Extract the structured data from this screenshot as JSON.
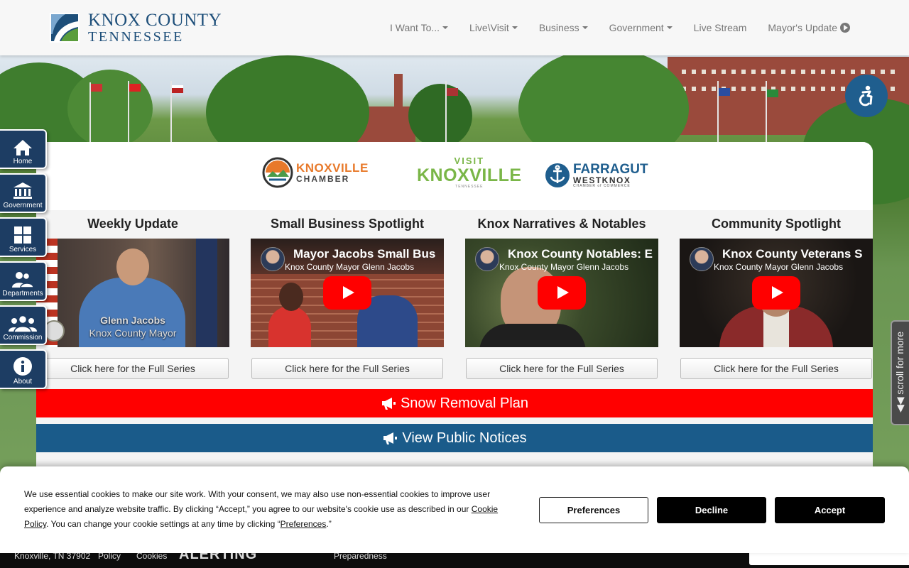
{
  "header": {
    "logo_line1": "KNOX COUNTY",
    "logo_line2": "TENNESSEE",
    "nav": [
      {
        "label": "I Want To...",
        "icon": "caret-down-icon"
      },
      {
        "label": "Live\\Visit",
        "icon": "caret-down-icon"
      },
      {
        "label": "Business",
        "icon": "caret-down-icon"
      },
      {
        "label": "Government",
        "icon": "caret-down-icon"
      },
      {
        "label": "Live Stream",
        "icon": ""
      },
      {
        "label": "Mayor's Update",
        "icon": "play-circle-icon"
      }
    ]
  },
  "sidebar": [
    {
      "label": "Home",
      "icon": "home-icon"
    },
    {
      "label": "Government",
      "icon": "building-columns-icon"
    },
    {
      "label": "Services",
      "icon": "grid-icon"
    },
    {
      "label": "Departments",
      "icon": "people-icon"
    },
    {
      "label": "Commission",
      "icon": "group-icon"
    },
    {
      "label": "About",
      "icon": "info-icon"
    }
  ],
  "partners": {
    "knoxville_chamber": {
      "line1": "KNOXVILLE",
      "line2": "CHAMBER"
    },
    "visit_knoxville": {
      "line1": "VISIT",
      "line2": "KNOXVILLE",
      "line3": "TENNESSEE"
    },
    "farragut": {
      "line1": "FARRAGUT",
      "line2": "WESTKNOX",
      "line3": "CHAMBER of COMMERCE"
    }
  },
  "columns": [
    {
      "title": "Weekly Update",
      "overlay_name": "Glenn Jacobs",
      "overlay_role": "Knox County Mayor",
      "button": "Click here for the Full Series"
    },
    {
      "title": "Small Business Spotlight",
      "video_title": "Mayor Jacobs Small Bus",
      "channel": "Knox County Mayor Glenn Jacobs",
      "button": "Click here for the Full Series"
    },
    {
      "title": "Knox Narratives & Notables",
      "video_title": "Knox County Notables: E",
      "channel": "Knox County Mayor Glenn Jacobs",
      "button": "Click here for the Full Series"
    },
    {
      "title": "Community Spotlight",
      "video_title": "Knox County Veterans S",
      "channel": "Knox County Mayor Glenn Jacobs",
      "button": "Click here for the Full Series"
    }
  ],
  "banners": {
    "snow": {
      "label": "Snow Removal Plan",
      "color": "#ff0000",
      "icon": "megaphone-icon"
    },
    "notices": {
      "label": "View Public Notices",
      "color": "#1a5b8a",
      "icon": "megaphone-icon"
    }
  },
  "scroll_hint": "scroll for more",
  "footer": {
    "address": "Knoxville, TN 37902",
    "policy": "Policy",
    "cookies": "Cookies",
    "alerting": "ALERTING",
    "preparedness": "Preparedness"
  },
  "cookie_banner": {
    "text_before": "We use essential cookies to make our site work. With your consent, we may also use non-essential cookies to improve user experience and analyze website traffic. By clicking “Accept,” you agree to our website's cookie use as described in our ",
    "policy_link": "Cookie Policy",
    "text_middle": ". You can change your cookie settings at any time by clicking “",
    "preferences_link": "Preferences",
    "text_after": ".”",
    "preferences_button": "Preferences",
    "decline_button": "Decline",
    "accept_button": "Accept"
  },
  "colors": {
    "navy": "#1d3d63",
    "brand_blue": "#1e4f7a",
    "snow_red": "#ff0000",
    "notice_blue": "#1a5b8a",
    "youtube_red": "#ff0000"
  }
}
